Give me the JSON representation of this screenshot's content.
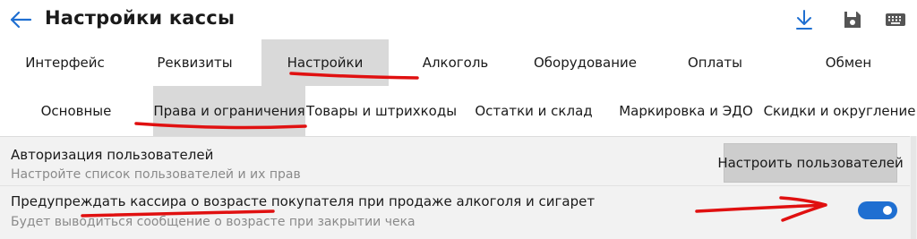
{
  "header": {
    "title": "Настройки кассы",
    "accent_color": "#1f6fd1",
    "icons": [
      "back-arrow-icon",
      "download-icon",
      "save-icon",
      "keyboard-icon"
    ]
  },
  "main_tabs": [
    {
      "label": "Интерфейс",
      "active": false
    },
    {
      "label": "Реквизиты",
      "active": false
    },
    {
      "label": "Настройки",
      "active": true
    },
    {
      "label": "Алкоголь",
      "active": false
    },
    {
      "label": "Оборудование",
      "active": false
    },
    {
      "label": "Оплаты",
      "active": false
    },
    {
      "label": "Обмен",
      "active": false
    }
  ],
  "sub_tabs": [
    {
      "label": "Основные",
      "active": false
    },
    {
      "label": "Права и ограничения",
      "active": true
    },
    {
      "label": "Товары и штрихкоды",
      "active": false
    },
    {
      "label": "Остатки и склад",
      "active": false
    },
    {
      "label": "Маркировка и ЭДО",
      "active": false
    },
    {
      "label": "Скидки и округление",
      "active": false
    }
  ],
  "settings": [
    {
      "title": "Авторизация пользователей",
      "subtitle": "Настройте список пользователей и их прав",
      "button_label": "Настроить пользователей"
    },
    {
      "title": "Предупреждать кассира о возрасте покупателя при продаже алкоголя и сигарет",
      "subtitle": "Будет выводиться сообщение о возрасте при закрытии чека",
      "toggle_on": true
    }
  ],
  "annotation_color": "#e01010"
}
